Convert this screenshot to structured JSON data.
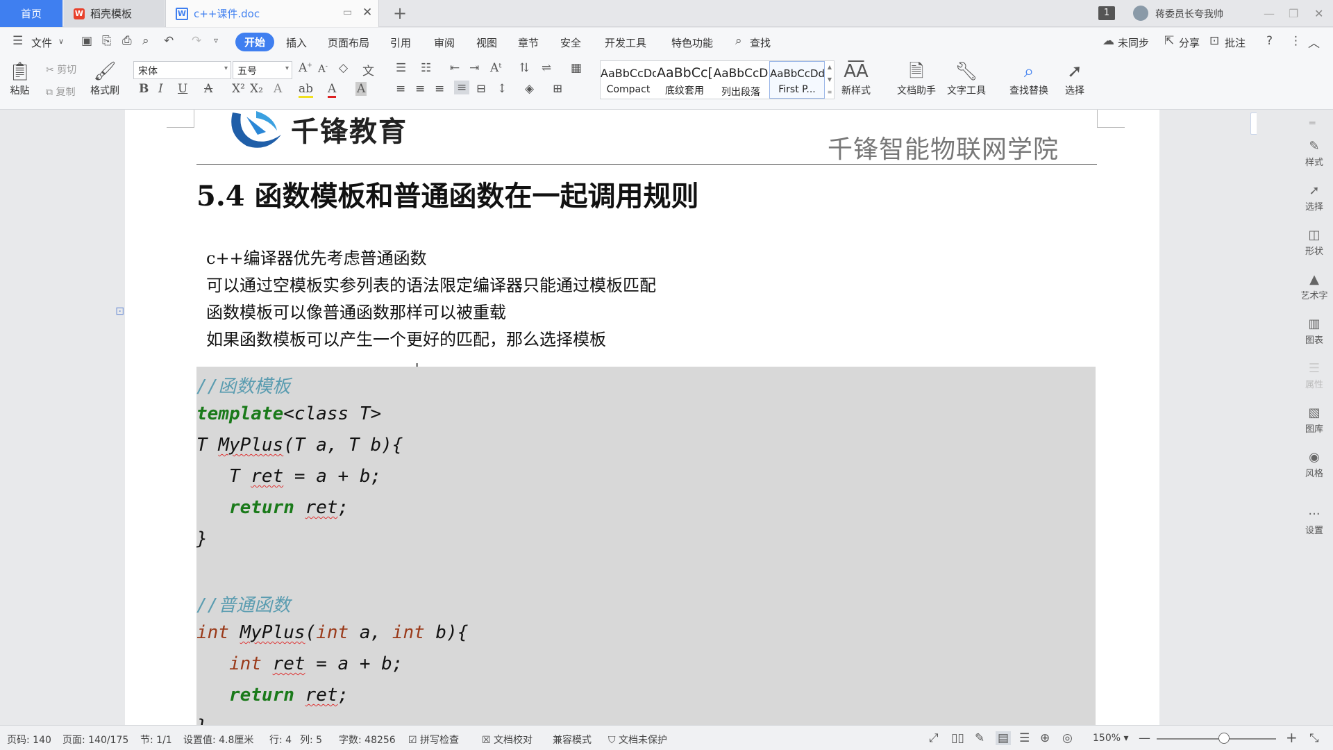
{
  "tabs": {
    "home": "首页",
    "templates": "稻壳模板",
    "document": "c++课件.doc",
    "new_tab": "+",
    "badge": "1",
    "user_name": "蒋委员长夸我帅"
  },
  "menu": {
    "file": "文件",
    "start": "开始",
    "insert": "插入",
    "layout": "页面布局",
    "reference": "引用",
    "review": "审阅",
    "view": "视图",
    "chapter": "章节",
    "security": "安全",
    "devtools": "开发工具",
    "special": "特色功能",
    "find": "查找",
    "sync": "未同步",
    "share": "分享",
    "comment": "批注"
  },
  "ribbon": {
    "paste": "粘贴",
    "cut": "剪切",
    "copy": "复制",
    "format_painter": "格式刷",
    "font_name": "宋体",
    "font_size": "五号",
    "styles": [
      {
        "preview": "AaBbCcDd",
        "name": "Compact"
      },
      {
        "preview": "AaBbCc[",
        "name": "底纹套用"
      },
      {
        "preview": "AaBbCcD",
        "name": "列出段落"
      },
      {
        "preview": "AaBbCcDd",
        "name": "First P..."
      }
    ],
    "new_style": "新样式",
    "doc_helper": "文档助手",
    "text_tools": "文字工具",
    "find_replace": "查找替换",
    "select": "选择"
  },
  "document": {
    "header_logo_text": "千锋教育",
    "header_right": "千锋智能物联网学院",
    "heading": "5.4  函数模板和普通函数在一起调用规则",
    "paragraphs": [
      "c++编译器优先考虑普通函数",
      "可以通过空模板实参列表的语法限定编译器只能通过模板匹配",
      "函数模板可以像普通函数那样可以被重载",
      "如果函数模板可以产生一个更好的匹配，那么选择模板"
    ],
    "code": {
      "c1": "//函数模板",
      "l1_kw": "template",
      "l1_rest": "<class T>",
      "l2_a": "T ",
      "l2_fn": "MyPlus",
      "l2_b": "(T a, T b){",
      "l3_a": "   T ",
      "l3_v": "ret",
      "l3_b": " = a + b;",
      "l4_kw": "   return ",
      "l4_v": "ret",
      "l4_b": ";",
      "l5": "}",
      "c2": "//普通函数",
      "l6_t1": "int ",
      "l6_fn": "MyPlus",
      "l6_b": "(",
      "l6_t2": "int",
      " l6_c": " a, ",
      "l6_t3": "int",
      "l6_d": " b){",
      "l7_t": "   int ",
      "l7_v": "ret",
      "l7_b": " = a + b;",
      "l8_kw": "   return ",
      "l8_v": "ret",
      "l8_b": ";",
      "l9": "}"
    }
  },
  "right_panel": {
    "style": "样式",
    "select": "选择",
    "shape": "形状",
    "art": "艺术字",
    "chart": "图表",
    "property": "属性",
    "gallery": "图库",
    "theme": "风格",
    "settings": "设置"
  },
  "status": {
    "page_code": "页码: 140",
    "page": "页面: 140/175",
    "section": "节: 1/1",
    "setting": "设置值: 4.8厘米",
    "row": "行: 4",
    "col": "列: 5",
    "words": "字数: 48256",
    "spell": "拼写检查",
    "proof": "文档校对",
    "compat": "兼容模式",
    "protect": "文档未保护",
    "zoom": "150%"
  },
  "colors": {
    "accent": "#3f7ff0",
    "comment": "#5a9cb0",
    "keyword": "#1a7a1a",
    "type": "#9a3a1a"
  }
}
